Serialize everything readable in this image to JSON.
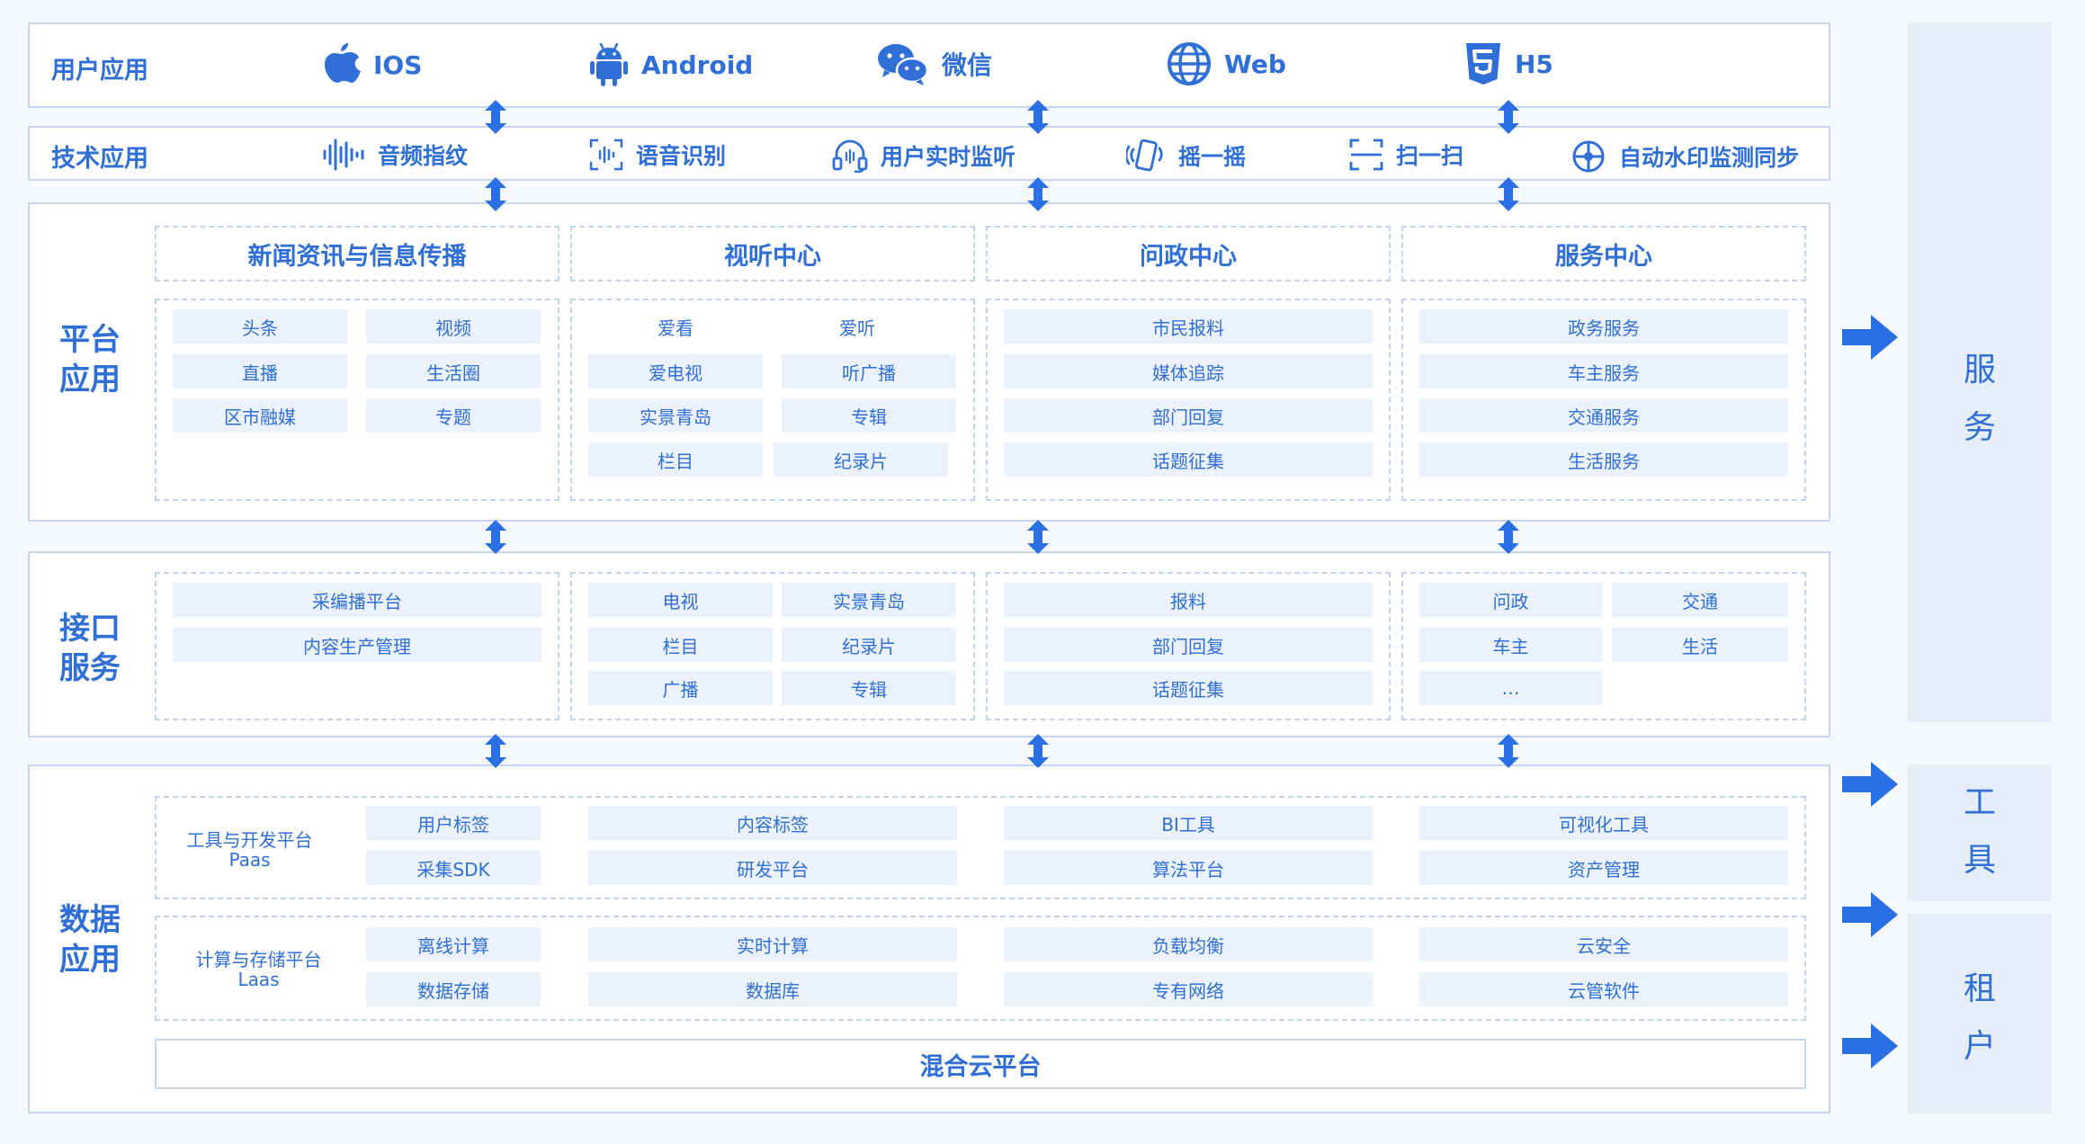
{
  "colors": {
    "accent": "#2f6fd6",
    "chip_bg": "#ebf2fd",
    "border": "#c6d6ee",
    "side_bg": "#e5edf9",
    "arrow": "#2b6fe4"
  },
  "user_app": {
    "label": "用户应用",
    "items": [
      {
        "icon": "apple-icon",
        "label": "IOS"
      },
      {
        "icon": "android-icon",
        "label": "Android"
      },
      {
        "icon": "wechat-icon",
        "label": "微信"
      },
      {
        "icon": "globe-icon",
        "label": "Web"
      },
      {
        "icon": "html5-icon",
        "label": "H5"
      }
    ]
  },
  "tech_app": {
    "label": "技术应用",
    "items": [
      {
        "icon": "audio-wave-icon",
        "label": "音频指纹"
      },
      {
        "icon": "voice-scan-icon",
        "label": "语音识别"
      },
      {
        "icon": "headset-icon",
        "label": "用户实时监听"
      },
      {
        "icon": "shake-phone-icon",
        "label": "摇一摇"
      },
      {
        "icon": "scan-icon",
        "label": "扫一扫"
      },
      {
        "icon": "watermark-icon",
        "label": "自动水印监测同步"
      }
    ]
  },
  "platform": {
    "label_lines": [
      "平台",
      "应用"
    ],
    "columns": [
      {
        "title": "新闻资讯与信息传播",
        "chips": [
          "头条",
          "视频",
          "直播",
          "生活圈",
          "区市融媒",
          "专题"
        ]
      },
      {
        "title": "视听中心",
        "chips": [
          "爱看",
          "爱听",
          "爱电视",
          "听广播",
          "实景青岛",
          "专辑",
          "栏目",
          "纪录片"
        ]
      },
      {
        "title": "问政中心",
        "chips": [
          "市民报料",
          "媒体追踪",
          "部门回复",
          "话题征集"
        ]
      },
      {
        "title": "服务中心",
        "chips": [
          "政务服务",
          "车主服务",
          "交通服务",
          "生活服务"
        ]
      }
    ]
  },
  "interface": {
    "label_lines": [
      "接口",
      "服务"
    ],
    "columns": [
      {
        "chips": [
          "采编播平台",
          "内容生产管理"
        ]
      },
      {
        "chips": [
          "电视",
          "实景青岛",
          "栏目",
          "纪录片",
          "广播",
          "专辑"
        ]
      },
      {
        "chips": [
          "报料",
          "部门回复",
          "话题征集"
        ]
      },
      {
        "chips": [
          "问政",
          "交通",
          "车主",
          "生活",
          "…"
        ]
      }
    ]
  },
  "data_app": {
    "label_lines": [
      "数据",
      "应用"
    ],
    "paas": {
      "label": "工具与开发平台",
      "sublabel": "Paas",
      "chips": [
        "用户标签",
        "采集SDK",
        "内容标签",
        "研发平台",
        "BI工具",
        "算法平台",
        "可视化工具",
        "资产管理"
      ]
    },
    "laas": {
      "label": "计算与存储平台",
      "sublabel": "Laas",
      "chips": [
        "离线计算",
        "数据存储",
        "实时计算",
        "数据库",
        "负载均衡",
        "专有网络",
        "云安全",
        "云管软件"
      ]
    },
    "cloud": "混合云平台"
  },
  "side": {
    "service": [
      "服",
      "务"
    ],
    "tools": [
      "工",
      "具"
    ],
    "tenant": [
      "租",
      "户"
    ]
  }
}
